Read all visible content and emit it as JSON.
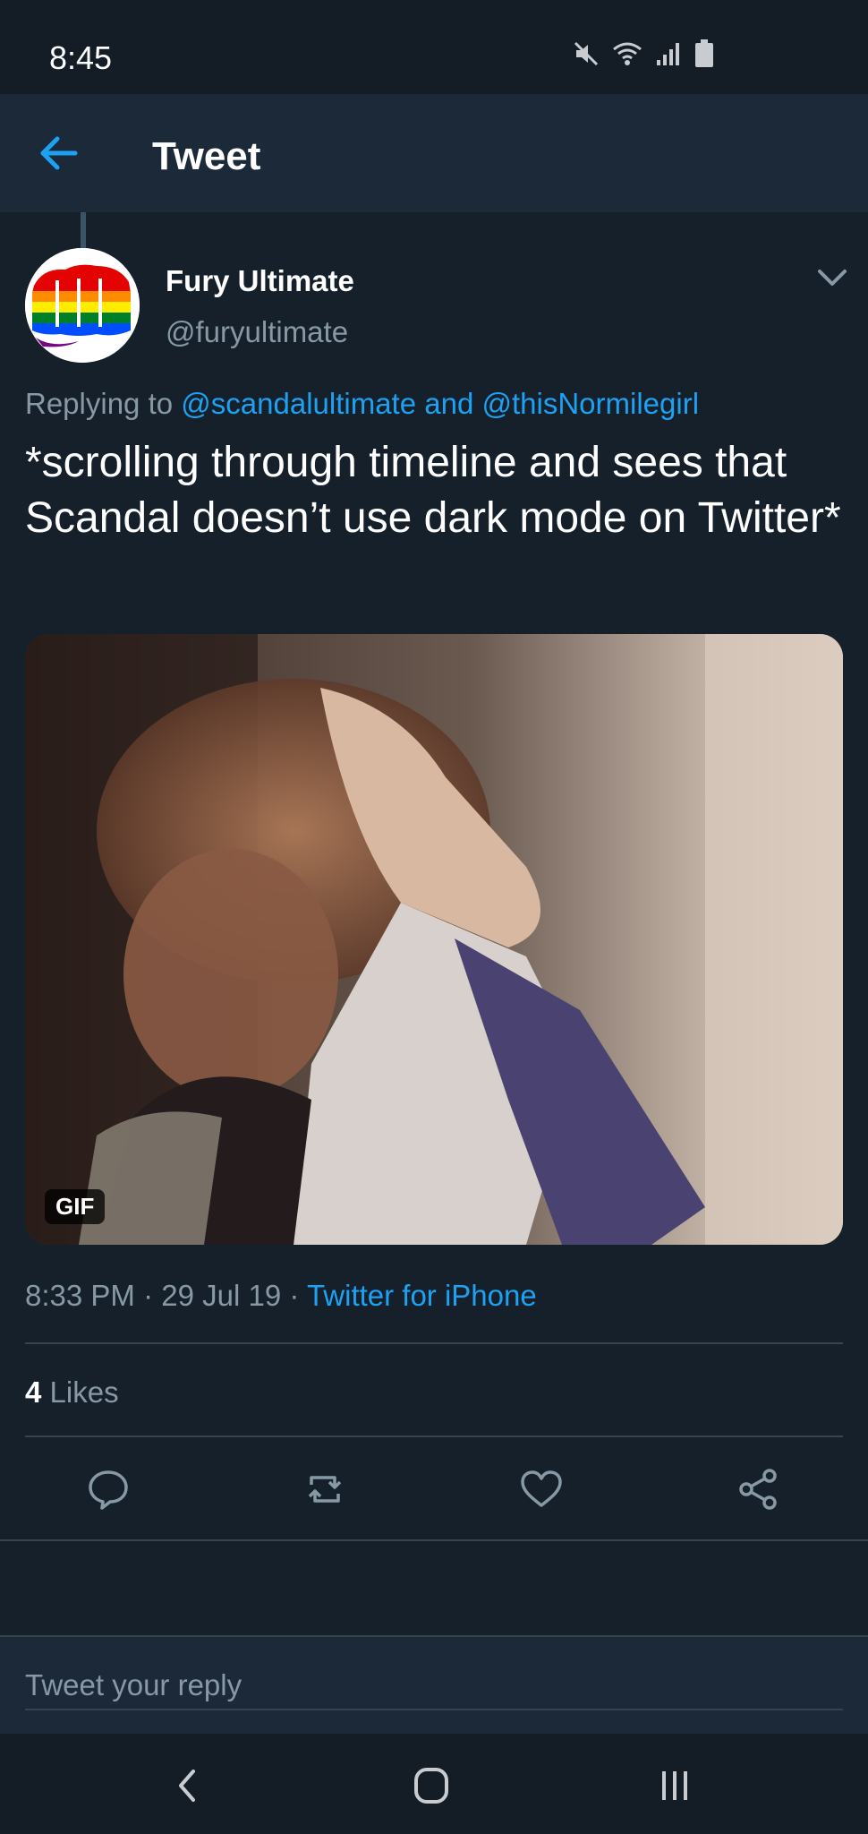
{
  "status_bar": {
    "time": "8:45",
    "icons": [
      "mute-icon",
      "wifi-icon",
      "signal-icon",
      "battery-icon"
    ]
  },
  "header": {
    "title": "Tweet",
    "back_icon": "arrow-left-icon"
  },
  "tweet": {
    "author_name": "Fury Ultimate",
    "author_handle": "@furyultimate",
    "replying_prefix": "Replying to",
    "reply_to_1": "@scandalultimate",
    "reply_and": "and",
    "reply_to_2": "@thisNormilegirl",
    "text": "*scrolling through timeline and sees that Scandal doesn’t use dark mode on Twitter*",
    "media_badge": "GIF",
    "time": "8:33 PM",
    "date": "29 Jul 19",
    "source": "Twitter for iPhone",
    "separator": "·",
    "likes_count": "4",
    "likes_label": "Likes"
  },
  "actions": [
    "reply-icon",
    "retweet-icon",
    "like-icon",
    "share-icon"
  ],
  "reply_bar": {
    "placeholder": "Tweet your reply"
  },
  "nav": [
    "back-nav-icon",
    "home-nav-icon",
    "recents-nav-icon"
  ],
  "colors": {
    "background": "#15202b",
    "header": "#1c2938",
    "accent": "#1da1f2",
    "secondary_text": "#8899a6",
    "divider": "#38444d"
  }
}
